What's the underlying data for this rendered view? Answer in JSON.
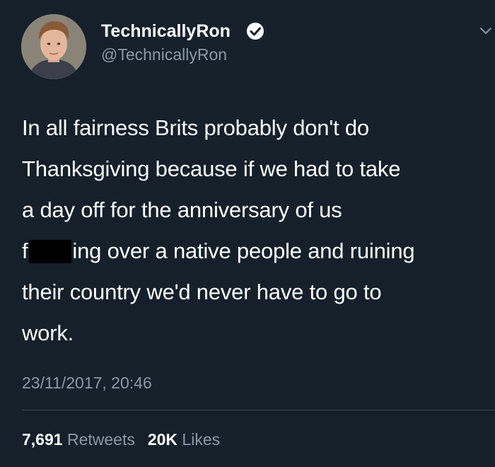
{
  "tweet": {
    "author": {
      "display_name": "TechnicallyRon",
      "handle": "@TechnicallyRon",
      "verified": true
    },
    "text_lines": [
      "In all fairness Brits probably don't do",
      "Thanksgiving because if we had to take",
      "a day off for the anniversary of us",
      {
        "before": "f",
        "after": "ing over a native people and ruining"
      },
      "their country we'd never have to go to",
      "work."
    ],
    "timestamp": "23/11/2017, 20:46",
    "stats": {
      "retweets_count": "7,691",
      "retweets_label": "Retweets",
      "likes_count": "20K",
      "likes_label": "Likes"
    }
  },
  "icons": {
    "verified": "verified-badge-icon",
    "menu": "chevron-down-icon"
  },
  "colors": {
    "background": "#15202b",
    "primary_text": "#ffffff",
    "secondary_text": "#8899a6",
    "divider": "#38444d",
    "censor_bar": "#000000"
  }
}
